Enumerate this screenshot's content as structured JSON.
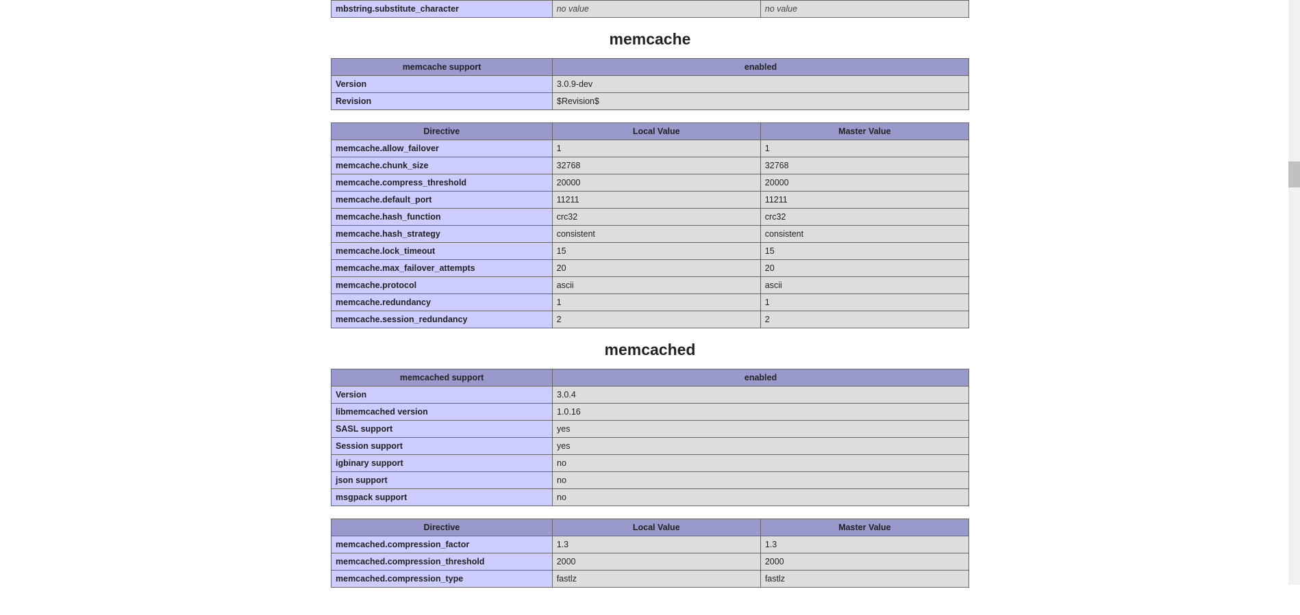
{
  "top_fragment": {
    "directive": "mbstring.substitute_character",
    "local": "no value",
    "master": "no value"
  },
  "sections": [
    {
      "title": "memcache",
      "support": {
        "header_left": "memcache support",
        "header_right": "enabled",
        "rows": [
          {
            "k": "Version",
            "v": "3.0.9-dev"
          },
          {
            "k": "Revision",
            "v": "$Revision$"
          }
        ]
      },
      "directives": {
        "headers": [
          "Directive",
          "Local Value",
          "Master Value"
        ],
        "rows": [
          {
            "d": "memcache.allow_failover",
            "l": "1",
            "m": "1"
          },
          {
            "d": "memcache.chunk_size",
            "l": "32768",
            "m": "32768"
          },
          {
            "d": "memcache.compress_threshold",
            "l": "20000",
            "m": "20000"
          },
          {
            "d": "memcache.default_port",
            "l": "11211",
            "m": "11211"
          },
          {
            "d": "memcache.hash_function",
            "l": "crc32",
            "m": "crc32"
          },
          {
            "d": "memcache.hash_strategy",
            "l": "consistent",
            "m": "consistent"
          },
          {
            "d": "memcache.lock_timeout",
            "l": "15",
            "m": "15"
          },
          {
            "d": "memcache.max_failover_attempts",
            "l": "20",
            "m": "20"
          },
          {
            "d": "memcache.protocol",
            "l": "ascii",
            "m": "ascii"
          },
          {
            "d": "memcache.redundancy",
            "l": "1",
            "m": "1"
          },
          {
            "d": "memcache.session_redundancy",
            "l": "2",
            "m": "2"
          }
        ]
      }
    },
    {
      "title": "memcached",
      "support": {
        "header_left": "memcached support",
        "header_right": "enabled",
        "rows": [
          {
            "k": "Version",
            "v": "3.0.4"
          },
          {
            "k": "libmemcached version",
            "v": "1.0.16"
          },
          {
            "k": "SASL support",
            "v": "yes"
          },
          {
            "k": "Session support",
            "v": "yes"
          },
          {
            "k": "igbinary support",
            "v": "no"
          },
          {
            "k": "json support",
            "v": "no"
          },
          {
            "k": "msgpack support",
            "v": "no"
          }
        ]
      },
      "directives": {
        "headers": [
          "Directive",
          "Local Value",
          "Master Value"
        ],
        "rows": [
          {
            "d": "memcached.compression_factor",
            "l": "1.3",
            "m": "1.3"
          },
          {
            "d": "memcached.compression_threshold",
            "l": "2000",
            "m": "2000"
          },
          {
            "d": "memcached.compression_type",
            "l": "fastlz",
            "m": "fastlz"
          }
        ]
      }
    }
  ]
}
